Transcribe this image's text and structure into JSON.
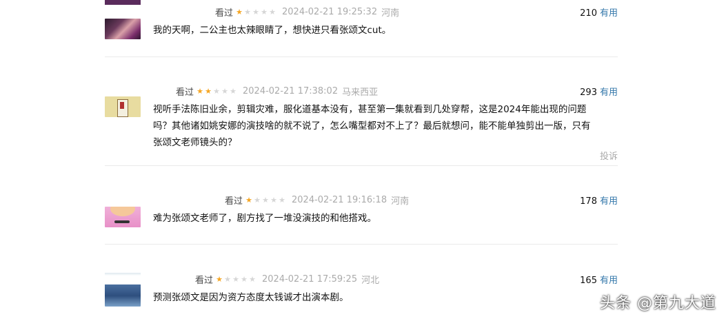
{
  "comments": [
    {
      "rating_label": "看过",
      "stars": 1,
      "time": "2024-02-21 19:25:32",
      "location": "河南",
      "votes": "210",
      "useful_label": "有用",
      "text": "我的天啊，二公主也太辣眼睛了，想快进只看张颂文cut。"
    },
    {
      "rating_label": "看过",
      "stars": 2,
      "time": "2024-02-21 17:38:02",
      "location": "马来西亚",
      "votes": "293",
      "useful_label": "有用",
      "text_lines": [
        "视听手法陈旧业余，剪辑灾难，服化道基本没有，甚至第一集就看到几处穿帮，这是2024年能出现的问题",
        "吗？其他诸如姚安娜的演技啥的就不说了，怎么嘴型都对不上了？最后就想问，能不能单独剪出一版，只有",
        "张颂文老师镜头的？"
      ],
      "report_label": "投诉"
    },
    {
      "rating_label": "看过",
      "stars": 1,
      "time": "2024-02-21 19:16:18",
      "location": "河南",
      "votes": "178",
      "useful_label": "有用",
      "text": "难为张颂文老师了，剧方找了一堆没演技的和他搭戏。"
    },
    {
      "rating_label": "看过",
      "stars": 1,
      "time": "2024-02-21 17:59:25",
      "location": "河北",
      "votes": "165",
      "useful_label": "有用",
      "text": "预测张颂文是因为资方态度太钱诚才出演本剧。"
    }
  ],
  "watermark": "头条 @第九大道",
  "colors": {
    "star_on": "#f5a623",
    "star_off": "#d6d6d6",
    "link": "#3377aa",
    "muted": "#aaaaaa"
  }
}
